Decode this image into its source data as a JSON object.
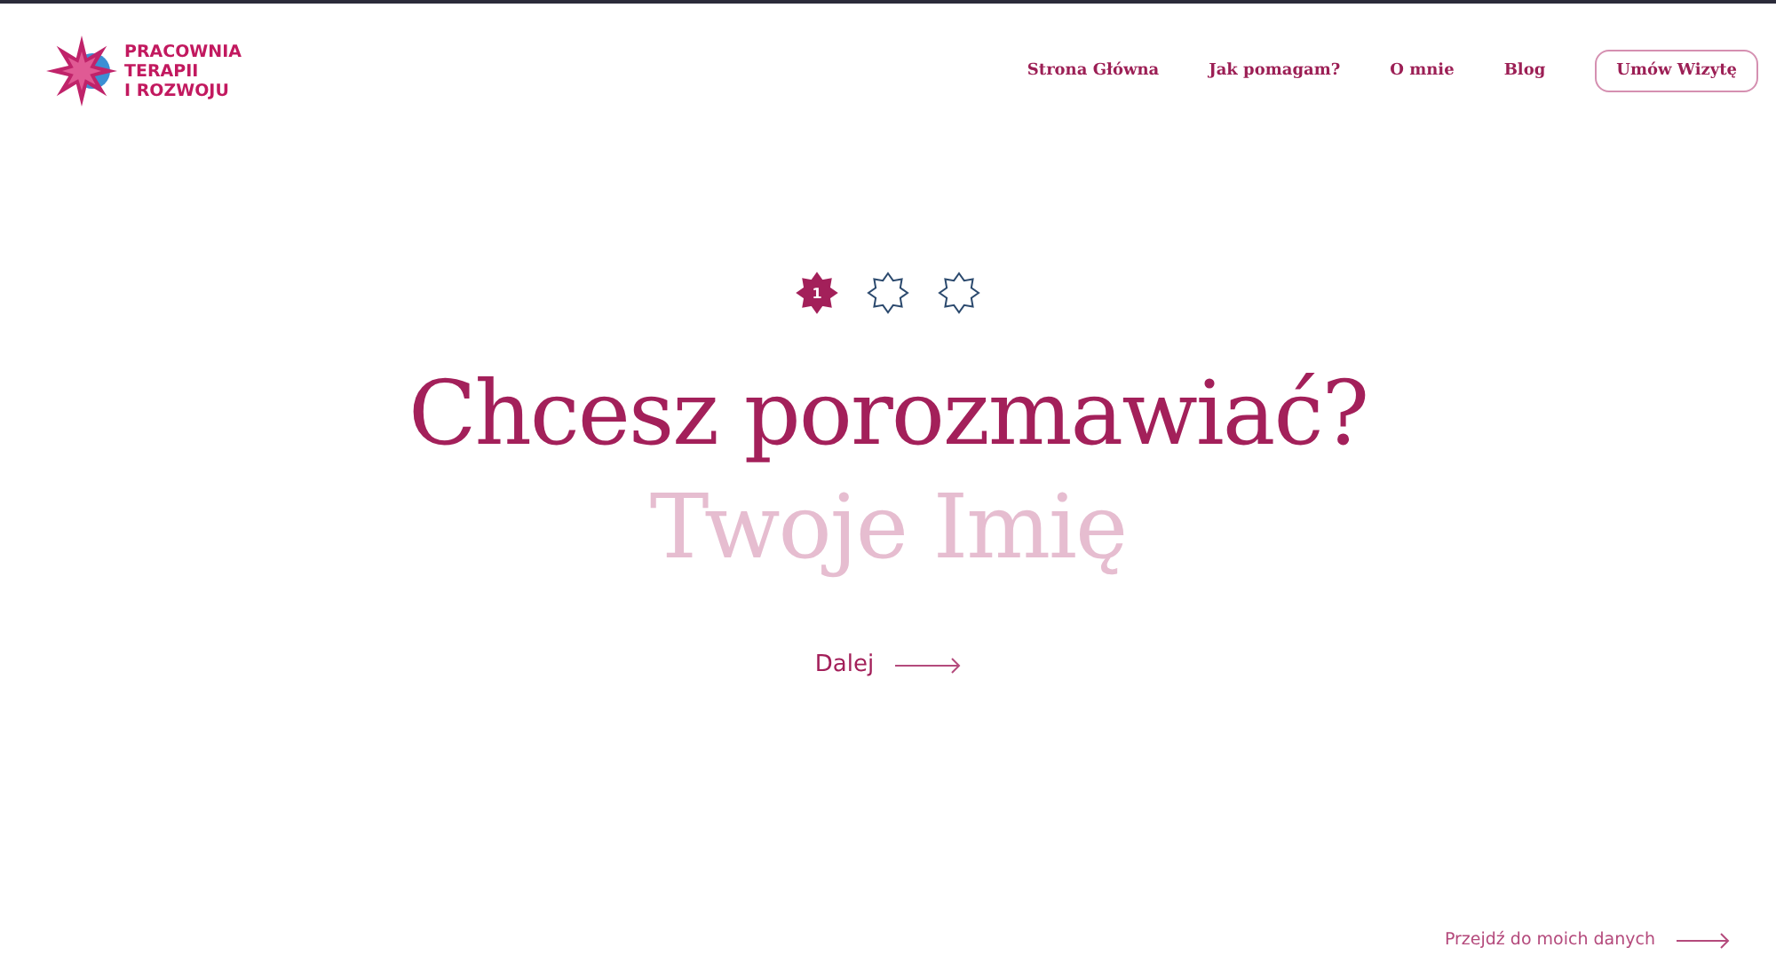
{
  "logo": {
    "lines": [
      "PRACOWNIA",
      "TERAPII",
      "I ROZWOJU"
    ]
  },
  "nav": {
    "links": [
      {
        "label": "Strona Główna"
      },
      {
        "label": "Jak pomagam?"
      },
      {
        "label": "O mnie"
      },
      {
        "label": "Blog"
      }
    ],
    "cta": "Umów Wizytę"
  },
  "steps": [
    {
      "label": "1",
      "selected": true
    },
    {
      "selected": false
    },
    {
      "selected": false
    }
  ],
  "form": {
    "question": "Chcesz porozmawiać?",
    "name_field": {
      "placeholder": "Twoje Imię"
    },
    "next": "Dalej"
  },
  "footer_link": "Przejdź do moich danych"
}
